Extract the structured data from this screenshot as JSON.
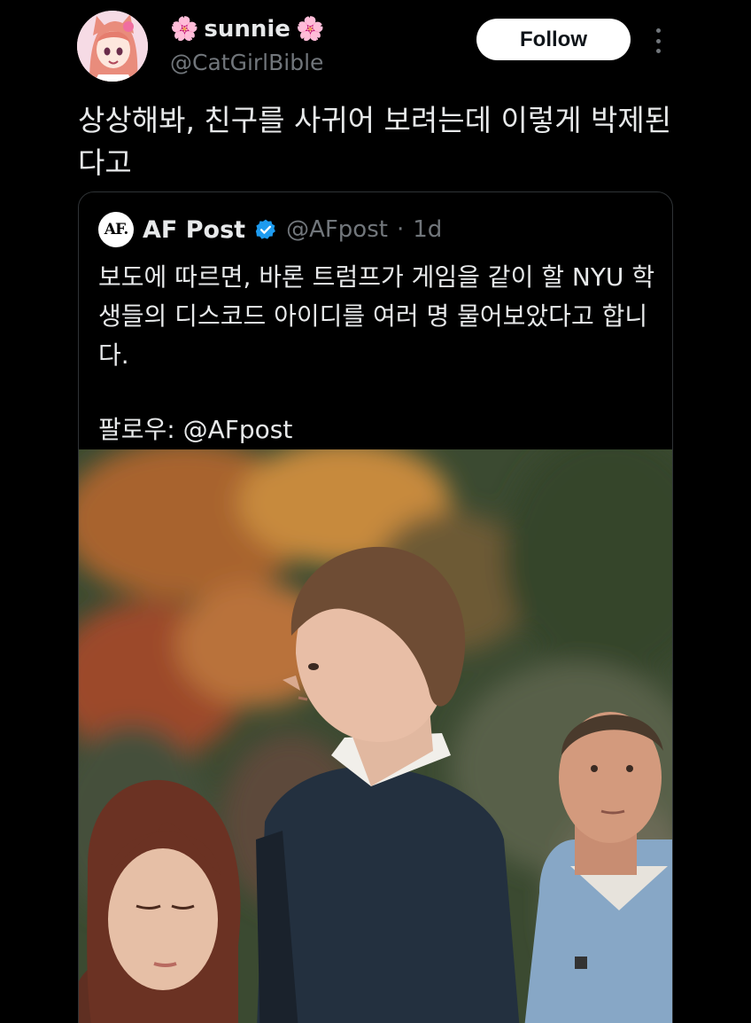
{
  "author": {
    "display_name": "sunnie",
    "flower_emoji": "🌸",
    "handle": "@CatGirlBible",
    "avatar_icon": "anime-catgirl-avatar"
  },
  "follow_label": "Follow",
  "more_icon": "more-vertical-icon",
  "tweet_text": "상상해봐, 친구를 사귀어 보려는데 이렇게 박제된다고",
  "quoted": {
    "logo_text": "AF.",
    "name": "AF Post",
    "verified_color": "#1d9bf0",
    "handle": "@AFpost",
    "separator": "·",
    "time": "1d",
    "text": "보도에 따르면, 바론 트럼프가 게임을 같이 할 NYU 학생들의 디스코드 아이디를 여러 명 물어보았다고 합니다.",
    "follow_line": "팔로우: @AFpost",
    "photo": "street-photo-young-man-in-navy-sweater"
  },
  "colors": {
    "background": "#000000",
    "text_primary": "#e7e9ea",
    "text_secondary": "#71767b",
    "border": "#2f3336"
  }
}
